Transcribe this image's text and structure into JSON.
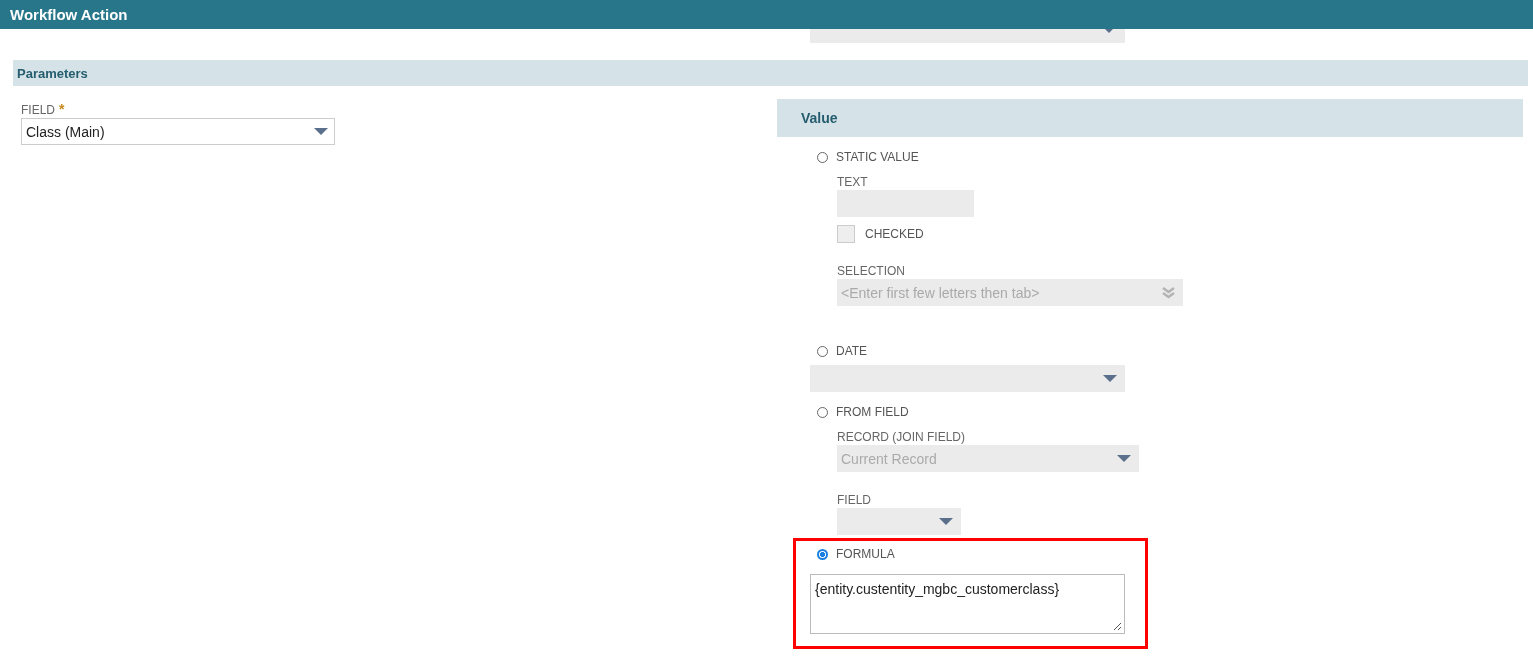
{
  "window": {
    "title": "Workflow Action"
  },
  "parameters": {
    "title": "Parameters",
    "field": {
      "label": "FIELD",
      "required_mark": "*",
      "value": "Class (Main)"
    }
  },
  "value_panel": {
    "title": "Value",
    "options": [
      {
        "kind": "static",
        "label": "STATIC VALUE",
        "selected": false,
        "text": {
          "label": "TEXT"
        },
        "checkbox": {
          "label": "CHECKED",
          "checked": false
        },
        "selection": {
          "label": "SELECTION",
          "placeholder": "<Enter first few letters then tab>"
        }
      },
      {
        "kind": "date",
        "label": "DATE",
        "selected": false
      },
      {
        "kind": "from_field",
        "label": "FROM FIELD",
        "selected": false,
        "record": {
          "label": "RECORD (JOIN FIELD)",
          "value": "Current Record"
        },
        "field": {
          "label": "FIELD"
        }
      },
      {
        "kind": "formula",
        "label": "FORMULA",
        "selected": true,
        "highlighted": true,
        "value": "{entity.custentity_mgbc_customerclass}"
      }
    ]
  }
}
